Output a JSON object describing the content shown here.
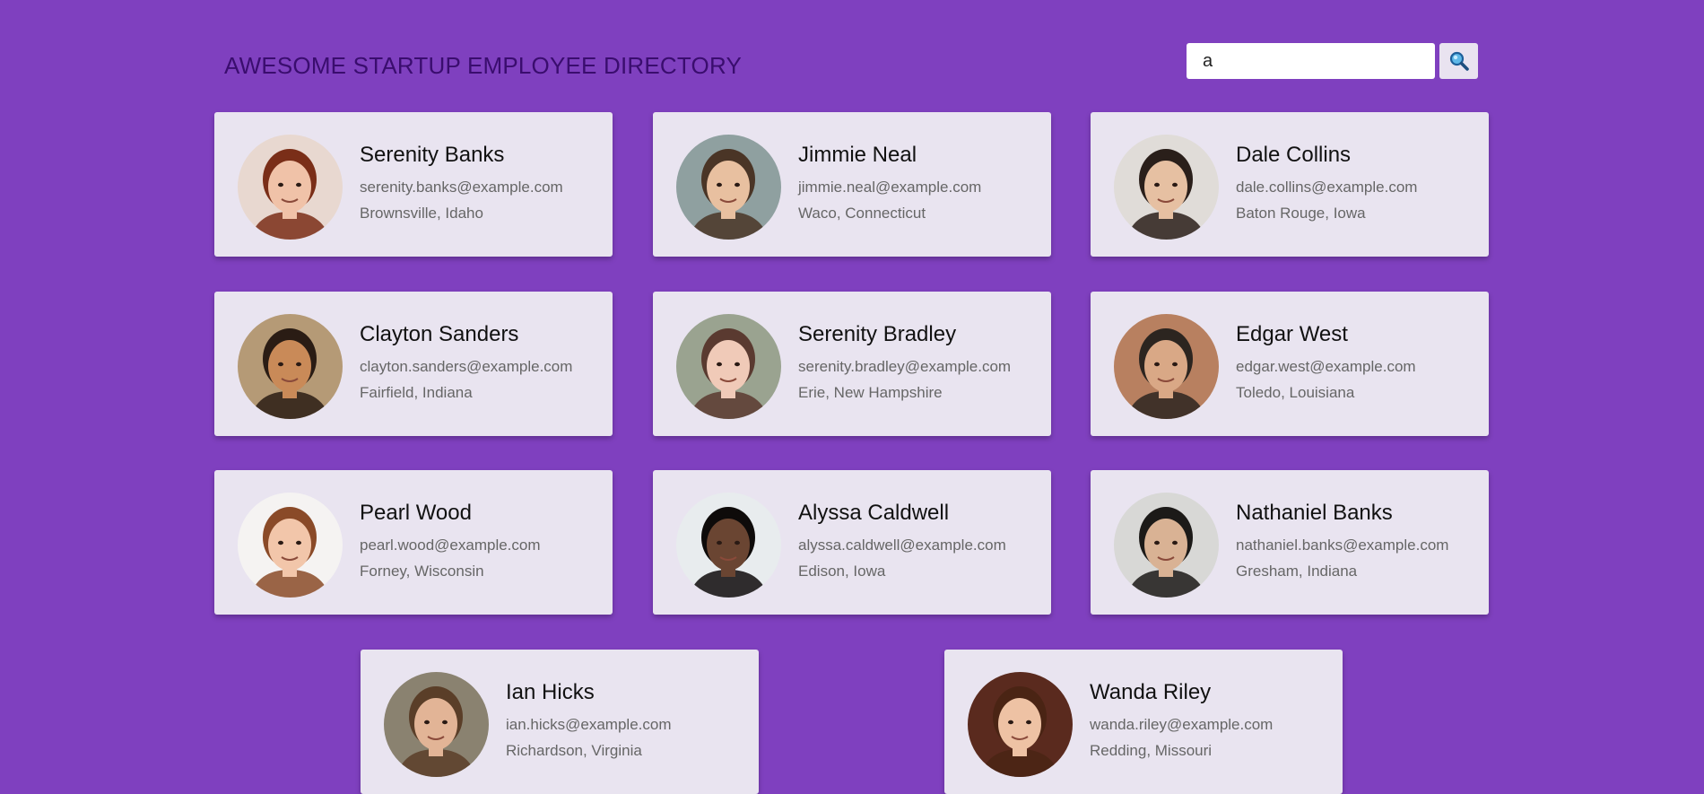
{
  "header": {
    "title": "AWESOME STARTUP EMPLOYEE DIRECTORY",
    "search_value": "a",
    "search_icon": "magnifier-icon"
  },
  "employees": [
    {
      "name": "Serenity Banks",
      "email": "serenity.banks@example.com",
      "location": "Brownsville, Idaho",
      "skin": "#f0c2a8",
      "hair": "#7a2e18",
      "bg": "#e8d8d0"
    },
    {
      "name": "Jimmie Neal",
      "email": "jimmie.neal@example.com",
      "location": "Waco, Connecticut",
      "skin": "#e8c0a0",
      "hair": "#4a3526",
      "bg": "#8fa0a0"
    },
    {
      "name": "Dale Collins",
      "email": "dale.collins@example.com",
      "location": "Baton Rouge, Iowa",
      "skin": "#e6c0a2",
      "hair": "#2a1f1a",
      "bg": "#e0dcd8"
    },
    {
      "name": "Clayton Sanders",
      "email": "clayton.sanders@example.com",
      "location": "Fairfield, Indiana",
      "skin": "#c98a58",
      "hair": "#2a1c14",
      "bg": "#b59a76"
    },
    {
      "name": "Serenity Bradley",
      "email": "serenity.bradley@example.com",
      "location": "Erie, New Hampshire",
      "skin": "#f0cab8",
      "hair": "#5a3a30",
      "bg": "#9aa390"
    },
    {
      "name": "Edgar West",
      "email": "edgar.west@example.com",
      "location": "Toledo, Louisiana",
      "skin": "#d9a886",
      "hair": "#2c2520",
      "bg": "#b88060"
    },
    {
      "name": "Pearl Wood",
      "email": "pearl.wood@example.com",
      "location": "Forney, Wisconsin",
      "skin": "#f2c6aa",
      "hair": "#8a4a28",
      "bg": "#f5f3f2"
    },
    {
      "name": "Alyssa Caldwell",
      "email": "alyssa.caldwell@example.com",
      "location": "Edison, Iowa",
      "skin": "#6a4532",
      "hair": "#0e0b0a",
      "bg": "#e8ecee"
    },
    {
      "name": "Nathaniel Banks",
      "email": "nathaniel.banks@example.com",
      "location": "Gresham, Indiana",
      "skin": "#d9b294",
      "hair": "#1c1a18",
      "bg": "#d8d8d6"
    },
    {
      "name": "Ian Hicks",
      "email": "ian.hicks@example.com",
      "location": "Richardson, Virginia",
      "skin": "#e2b496",
      "hair": "#5a3e28",
      "bg": "#8a8270"
    },
    {
      "name": "Wanda Riley",
      "email": "wanda.riley@example.com",
      "location": "Redding, Missouri",
      "skin": "#eec2a4",
      "hair": "#4a2414",
      "bg": "#5a2a1e"
    }
  ]
}
